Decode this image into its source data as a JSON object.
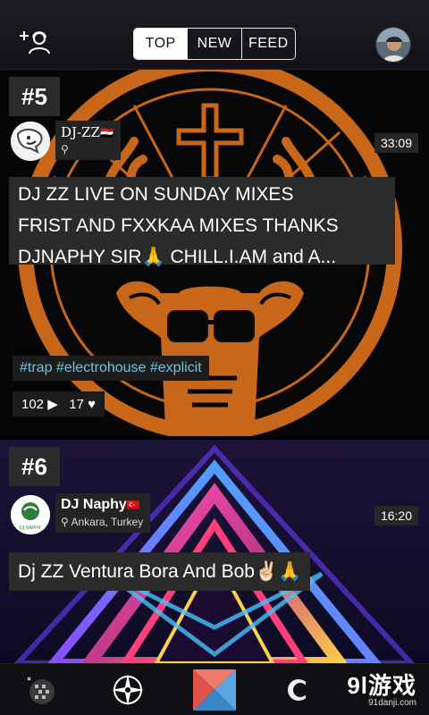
{
  "header": {
    "tabs": [
      "TOP",
      "NEW",
      "FEED"
    ],
    "active_tab": "TOP"
  },
  "cards": [
    {
      "rank": "#5",
      "dj_name": "DJ-ZZ",
      "dj_flag": "🇪🇬",
      "location": "",
      "duration": "33:09",
      "title_lines": [
        "DJ ZZ LIVE ON SUNDAY MIXES",
        "FRIST AND FXXKAA MIXES THANKS",
        "DJNAPHY SIR🙏 CHILL.I.AM and A..."
      ],
      "tags": "#trap #electrohouse #explicit",
      "plays": "102",
      "likes": "17"
    },
    {
      "rank": "#6",
      "dj_name": "DJ Naphy",
      "dj_flag": "🇹🇷",
      "location": "Ankara, Turkey",
      "avatar_text": "DJ NAPHY",
      "duration": "16:20",
      "title": "Dj ZZ Ventura Bora And Bob✌🏻🙏"
    }
  ],
  "watermark": {
    "main": "9l游戏",
    "sub": "91danji.com"
  },
  "colors": {
    "accent_orange": "#d4701c",
    "tag_blue": "#6fc3e0",
    "nav_red": "#e0524a",
    "nav_blue": "#5aa6e0"
  }
}
